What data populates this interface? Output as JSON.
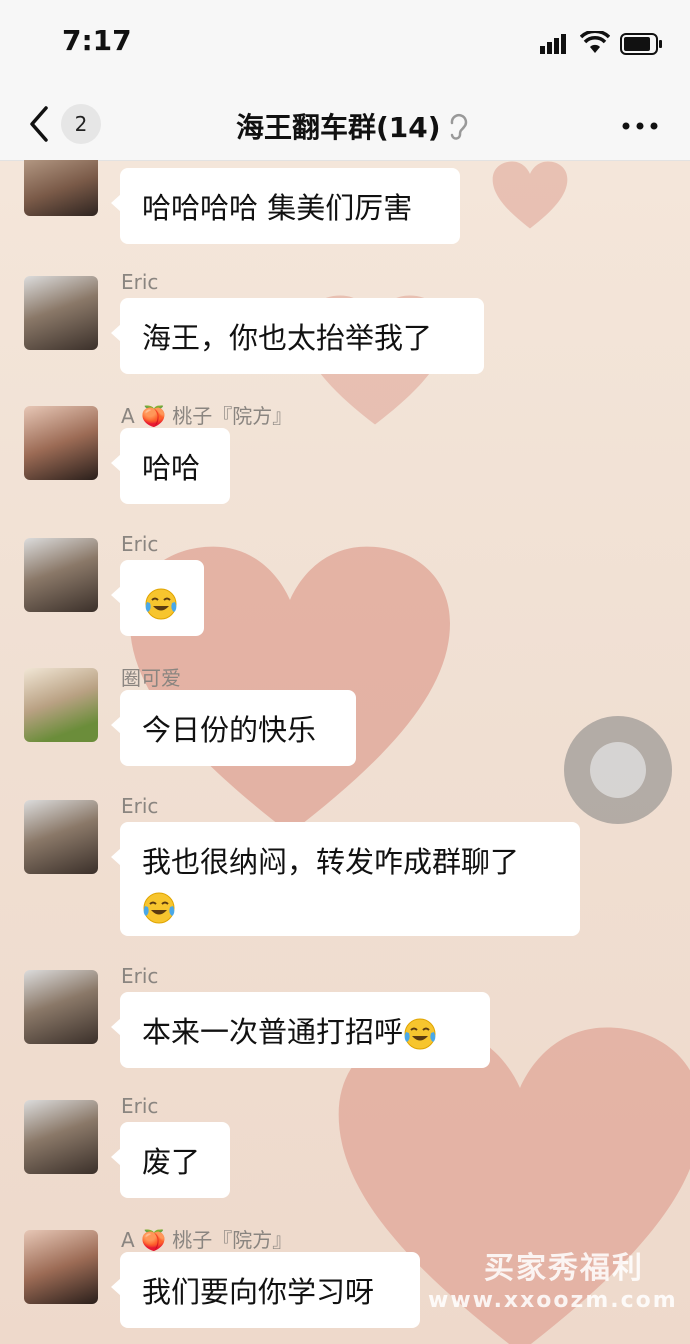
{
  "status_bar": {
    "time": "7:17"
  },
  "nav": {
    "unread_badge": "2",
    "title": "海王翻车群(14)"
  },
  "messages": [
    {
      "sender": "",
      "text": "哈哈哈哈 集美们厉害",
      "avatar": "female-avatar"
    },
    {
      "sender": "Eric",
      "text": "海王，你也太抬举我了",
      "avatar": "eric-avatar"
    },
    {
      "sender": "A 🍑 桃子『院方』",
      "text": "哈哈",
      "avatar": "female-avatar"
    },
    {
      "sender": "Eric",
      "text": "",
      "emoji": "tears-of-joy",
      "avatar": "eric-avatar"
    },
    {
      "sender": "圈可爱",
      "text": "今日份的快乐",
      "avatar": "flower-avatar"
    },
    {
      "sender": "Eric",
      "text": "我也很纳闷，转发咋成群聊了",
      "emoji": "tears-of-joy",
      "avatar": "eric-avatar"
    },
    {
      "sender": "Eric",
      "text": "本来一次普通打招呼",
      "emoji": "tears-of-joy",
      "avatar": "eric-avatar"
    },
    {
      "sender": "Eric",
      "text": "废了",
      "avatar": "eric-avatar"
    },
    {
      "sender": "A 🍑 桃子『院方』",
      "text": "我们要向你学习呀",
      "avatar": "female-avatar"
    }
  ],
  "watermark": {
    "line1": "买家秀福利",
    "line2": "www.xxoozm.com"
  },
  "colors": {
    "bubble": "#ffffff",
    "background": "#f1e2d5",
    "heart": "#e2a89a"
  }
}
